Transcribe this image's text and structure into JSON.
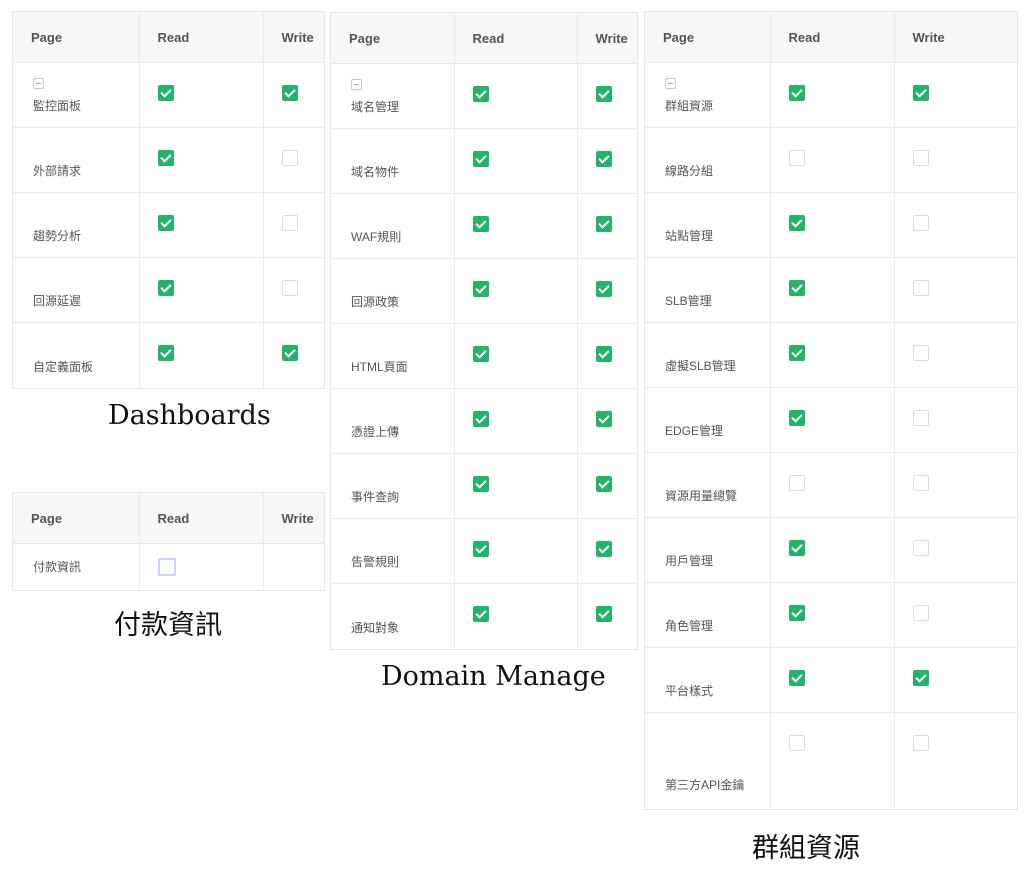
{
  "header": {
    "page": "Page",
    "read": "Read",
    "write": "Write"
  },
  "dashboards": {
    "caption": "Dashboards",
    "rows": [
      {
        "label": "監控面板",
        "read": true,
        "write": true
      },
      {
        "label": "外部請求",
        "read": true,
        "write": false
      },
      {
        "label": "趨勢分析",
        "read": true,
        "write": false
      },
      {
        "label": "回源延遲",
        "read": true,
        "write": false
      },
      {
        "label": "自定義面板",
        "read": true,
        "write": true
      }
    ]
  },
  "payment": {
    "caption": "付款資訊",
    "rows": [
      {
        "label": "付款資訊",
        "read": false
      }
    ]
  },
  "domain": {
    "caption": "Domain Manage",
    "rows": [
      {
        "label": "域名管理",
        "read": true,
        "write": true
      },
      {
        "label": "域名物件",
        "read": true,
        "write": true
      },
      {
        "label": "WAF規則",
        "read": true,
        "write": true
      },
      {
        "label": "回源政策",
        "read": true,
        "write": true
      },
      {
        "label": "HTML頁面",
        "read": true,
        "write": true
      },
      {
        "label": "憑證上傳",
        "read": true,
        "write": true
      },
      {
        "label": "事件查詢",
        "read": true,
        "write": true
      },
      {
        "label": "告警規則",
        "read": true,
        "write": true
      },
      {
        "label": "通知對象",
        "read": true,
        "write": true
      }
    ]
  },
  "group": {
    "caption": "群組資源",
    "rows": [
      {
        "label": "群組資源",
        "read": true,
        "write": true
      },
      {
        "label": "線路分組",
        "read": false,
        "write": false
      },
      {
        "label": "站點管理",
        "read": true,
        "write": false
      },
      {
        "label": "SLB管理",
        "read": true,
        "write": false
      },
      {
        "label": "虛擬SLB管理",
        "read": true,
        "write": false
      },
      {
        "label": "EDGE管理",
        "read": true,
        "write": false
      },
      {
        "label": "資源用量總覽",
        "read": false,
        "write": false
      },
      {
        "label": "用戶管理",
        "read": true,
        "write": false
      },
      {
        "label": "角色管理",
        "read": true,
        "write": false
      },
      {
        "label": "平台樣式",
        "read": true,
        "write": true
      },
      {
        "label": "第三方API金鑰",
        "read": false,
        "write": false
      }
    ]
  }
}
